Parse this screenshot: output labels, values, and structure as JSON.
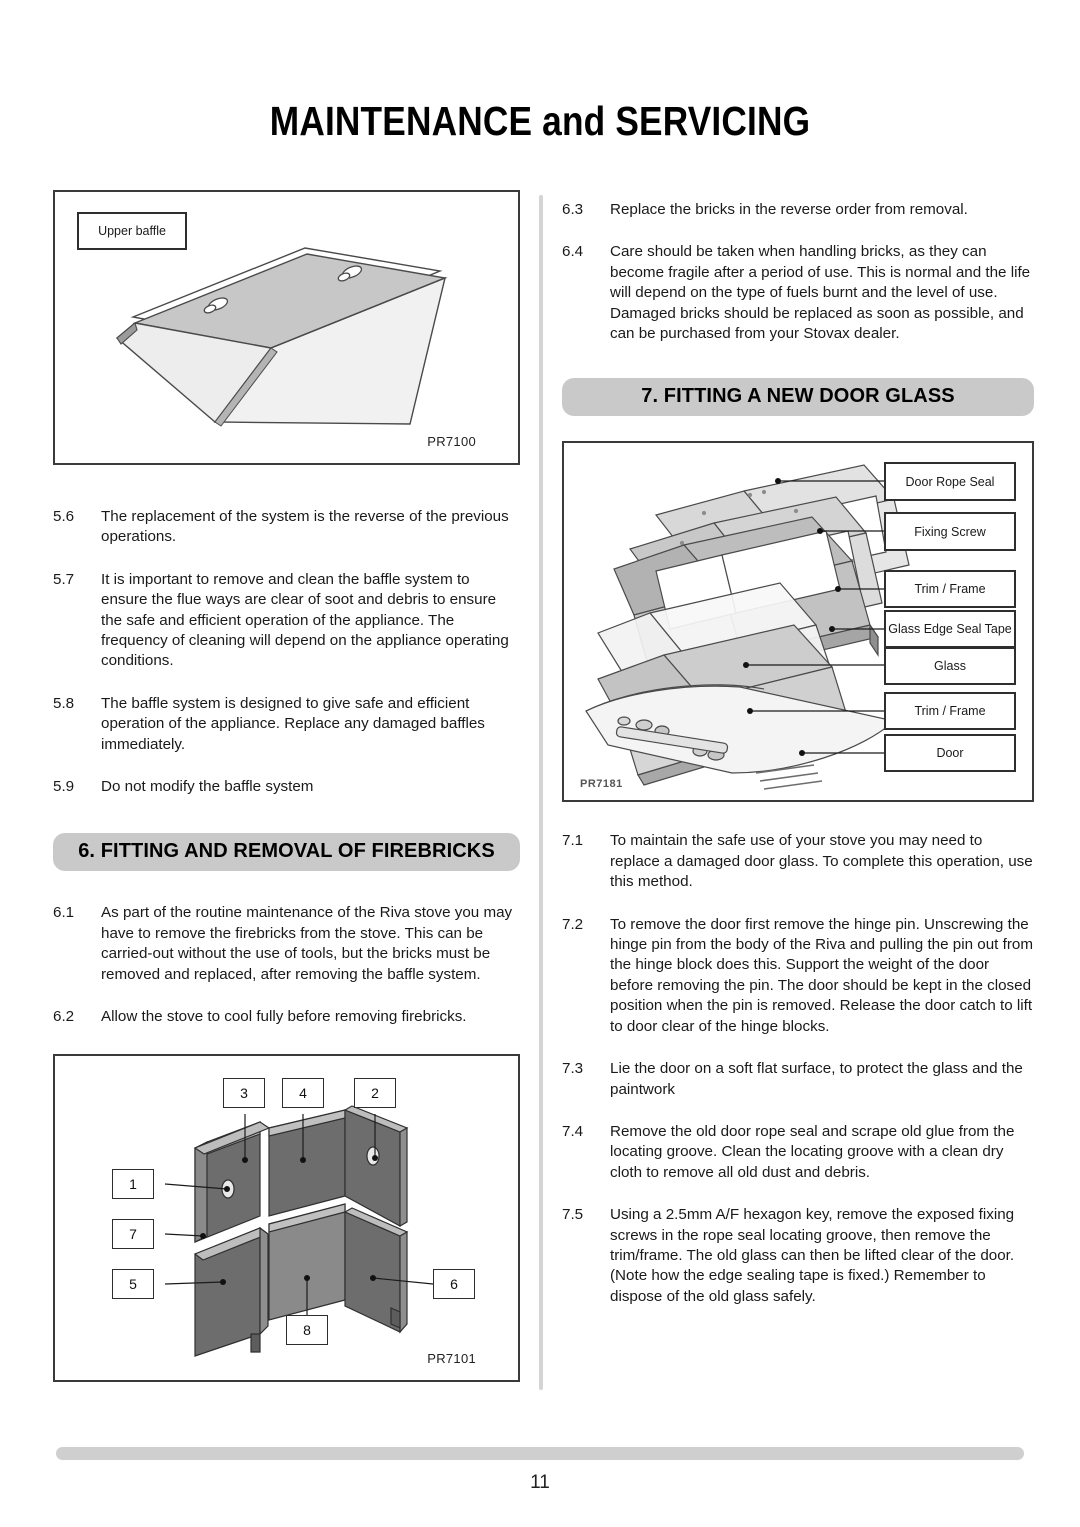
{
  "document": {
    "title": "MAINTENANCE and SERVICING",
    "page_number": "11"
  },
  "left_column": {
    "figure_upper_baffle": {
      "callout_label": "Upper baffle",
      "figure_code": "PR7100"
    },
    "paragraphs": [
      {
        "num": "5.6",
        "text": "The replacement of the system is the reverse of the previous operations."
      },
      {
        "num": "5.7",
        "text": "It is important to remove and clean the baffle system to ensure the flue ways are clear of soot and debris to ensure the safe and efficient operation of the appliance. The frequency of cleaning will depend on the appliance operating conditions."
      },
      {
        "num": "5.8",
        "text": "The baffle system is designed to give safe and efficient operation of the appliance. Replace any damaged baffles immediately."
      },
      {
        "num": "5.9",
        "text": "Do not modify the baffle system"
      }
    ],
    "section_heading": "6. FITTING AND REMOVAL OF FIREBRICKS",
    "section_paragraphs": [
      {
        "num": "6.1",
        "text": "As part of the routine maintenance of the Riva stove you may have to remove the firebricks from the stove. This can be carried-out without the use of tools, but the bricks must be removed and replaced, after removing the baffle system."
      },
      {
        "num": "6.2",
        "text": "Allow the stove to cool fully before removing firebricks."
      }
    ],
    "figure_firebricks": {
      "figure_code": "PR7101",
      "callouts": [
        "3",
        "4",
        "2",
        "1",
        "7",
        "5",
        "6",
        "8"
      ]
    }
  },
  "right_column": {
    "paragraphs": [
      {
        "num": "6.3",
        "text": "Replace the bricks in the reverse order from removal."
      },
      {
        "num": "6.4",
        "text": "Care should be taken when handling bricks, as they can become fragile after a period of use. This is normal and the life will depend on the type of fuels burnt and the level of use. Damaged bricks should be replaced as soon as possible, and can be purchased from your Stovax dealer."
      }
    ],
    "section_heading": "7. FITTING A NEW DOOR GLASS",
    "figure_door_glass": {
      "figure_code": "PR7181",
      "callouts": [
        "Door Rope Seal",
        "Fixing Screw",
        "Trim / Frame",
        "Glass Edge Seal Tape",
        "Glass",
        "Trim / Frame",
        "Door"
      ]
    },
    "section_paragraphs": [
      {
        "num": "7.1",
        "text": "To maintain the safe use of your stove you may need to replace a damaged door glass. To complete this operation, use this method."
      },
      {
        "num": "7.2",
        "text": "To remove the door first remove the hinge pin. Unscrewing the hinge pin from the body of the Riva and pulling the pin out from the hinge block does this. Support the weight of the door before removing the pin. The door should be kept in the closed position when the pin is removed. Release the door catch to lift to door clear of the hinge blocks."
      },
      {
        "num": "7.3",
        "text": "Lie the door on a soft flat surface, to protect the glass and the paintwork"
      },
      {
        "num": "7.4",
        "text": "Remove the old door rope seal and scrape old glue from the locating groove. Clean the locating groove with a clean dry cloth to remove all old dust and debris."
      },
      {
        "num": "7.5",
        "text": "Using a 2.5mm A/F hexagon key, remove the exposed fixing screws in the rope seal locating groove, then remove the trim/frame. The old glass can then be lifted clear of the door. (Note how the edge sealing tape is fixed.) Remember to dispose of the old glass safely."
      }
    ]
  },
  "colors": {
    "section_bar": "#c9c9c9",
    "footer_rule": "#cfcfcf",
    "divider": "#d4d4d4",
    "metal_light": "#e9e9e9",
    "metal_mid": "#c4c4c4",
    "brick_gray": "#6e6e6e"
  }
}
